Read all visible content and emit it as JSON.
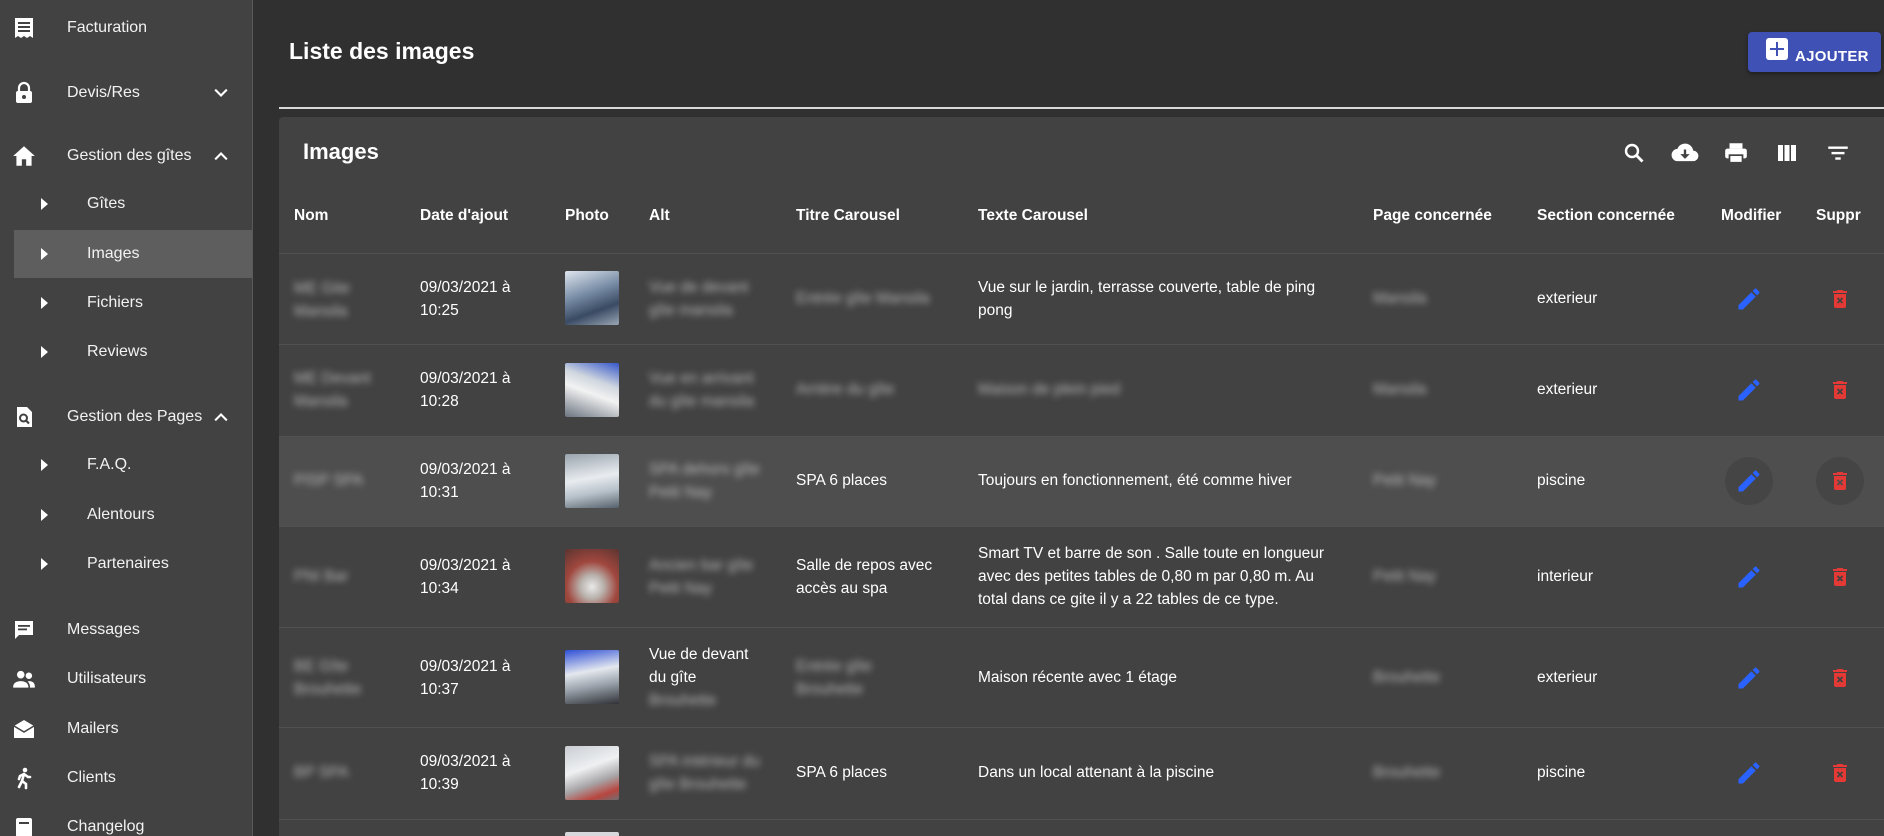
{
  "sidebar": {
    "items": [
      {
        "label": "Facturation",
        "icon": "invoice-icon"
      },
      {
        "label": "Devis/Res",
        "icon": "lock-icon"
      },
      {
        "label": "Gestion des gîtes",
        "icon": "home-icon"
      },
      {
        "label": "Gîtes"
      },
      {
        "label": "Images"
      },
      {
        "label": "Fichiers"
      },
      {
        "label": "Reviews"
      },
      {
        "label": "Gestion des Pages",
        "icon": "page-search-icon"
      },
      {
        "label": "F.A.Q."
      },
      {
        "label": "Alentours"
      },
      {
        "label": "Partenaires"
      },
      {
        "label": "Messages",
        "icon": "message-icon"
      },
      {
        "label": "Utilisateurs",
        "icon": "users-icon"
      },
      {
        "label": "Mailers",
        "icon": "mail-open-icon"
      },
      {
        "label": "Clients",
        "icon": "person-walking-icon"
      },
      {
        "label": "Changelog",
        "icon": "changelog-icon"
      }
    ]
  },
  "header": {
    "title": "Liste des images",
    "add_label": "AJOUTER"
  },
  "table": {
    "title": "Images",
    "toolbar": [
      "search-icon",
      "download-icon",
      "print-icon",
      "columns-icon",
      "filter-icon"
    ],
    "columns": [
      "Nom",
      "Date d'ajout",
      "Photo",
      "Alt",
      "Titre Carousel",
      "Texte Carousel",
      "Page concernée",
      "Section concernée",
      "Modifier",
      "Suppr"
    ],
    "rows": [
      {
        "nom": [
          "ME Gite",
          "Mansila"
        ],
        "date": [
          "09/03/2021 à",
          "10:25"
        ],
        "alt": [
          "Vue de devant",
          "gîte mansila"
        ],
        "titre": [
          "Entrée gîte Mansila"
        ],
        "texte": [
          "Vue sur le jardin, terrasse couverte, table de ping",
          "pong"
        ],
        "page": "Mansila",
        "section": "exterieur"
      },
      {
        "nom": [
          "ME Devant",
          "Mansila"
        ],
        "date": [
          "09/03/2021 à",
          "10:28"
        ],
        "alt": [
          "Vue en arrivant",
          "du gîte mansila"
        ],
        "titre": [
          "Arrière du gîte"
        ],
        "texte": [
          "Maison de plein pied"
        ],
        "page": "Mansila",
        "section": "exterieur"
      },
      {
        "nom": [
          "PISP SPA"
        ],
        "date": [
          "09/03/2021 à",
          "10:31"
        ],
        "alt": [
          "SPA dehors gîte",
          "Petit Nay"
        ],
        "titre": [
          "SPA 6 places"
        ],
        "texte": [
          "Toujours en fonctionnement, été comme hiver"
        ],
        "page": "Petit Nay",
        "section": "piscine"
      },
      {
        "nom": [
          "PNI Bar"
        ],
        "date": [
          "09/03/2021 à",
          "10:34"
        ],
        "alt": [
          "Ancien bar gîte",
          "Petit Nay"
        ],
        "titre": [
          "Salle de repos avec",
          "accès au spa"
        ],
        "texte": [
          "Smart TV et barre de son . Salle toute en longueur",
          "avec des petites tables de 0,80 m par 0,80 m. Au",
          "total dans ce gite il y a 22 tables de ce type."
        ],
        "page": "Petit Nay",
        "section": "interieur"
      },
      {
        "nom": [
          "BE Gîte",
          "Brouhette"
        ],
        "date": [
          "09/03/2021 à",
          "10:37"
        ],
        "alt": [
          "Vue de devant",
          "du gîte",
          "Brouhette"
        ],
        "titre": [
          "Entrée gîte",
          "Brouhette"
        ],
        "texte": [
          "Maison récente avec 1 étage"
        ],
        "page": "Brouhette",
        "section": "exterieur"
      },
      {
        "nom": [
          "BP SPA"
        ],
        "date": [
          "09/03/2021 à",
          "10:39"
        ],
        "alt": [
          "SPA intérieur du",
          "gîte Brouhette"
        ],
        "titre": [
          "SPA 6 places"
        ],
        "texte": [
          "Dans un local attenant à la piscine"
        ],
        "page": "Brouhette",
        "section": "piscine"
      }
    ]
  },
  "colors": {
    "accent_blue": "#2962ff",
    "delete_red": "#e53935",
    "primary_button": "#3f51b5",
    "sidebar_bg": "#424242",
    "page_bg": "#303030"
  }
}
